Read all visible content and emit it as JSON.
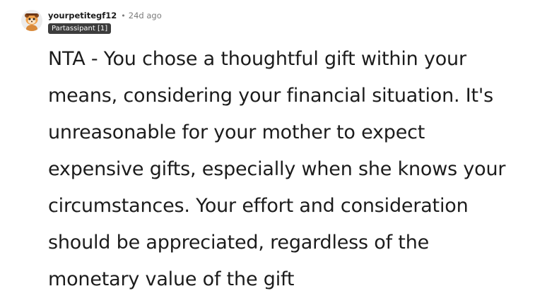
{
  "comment": {
    "author": "yourpetitegf12",
    "separator": "•",
    "time_ago": "24d ago",
    "flair": "Partassipant [1]",
    "avatar_icon": "snoo-avatar-icon",
    "body_lines": [
      "NTA - You chose a thoughtful gift within your",
      "means, considering your financial situation. It's",
      "unreasonable for your mother to expect",
      "expensive gifts, especially when she knows your",
      "circumstances. Your effort and consideration",
      "should be appreciated, regardless of the",
      "monetary value of the gift"
    ]
  },
  "colors": {
    "text": "#1c1c1c",
    "meta": "#7c7c7c",
    "flair_bg": "#3d3d3d",
    "flair_text": "#ffffff"
  }
}
